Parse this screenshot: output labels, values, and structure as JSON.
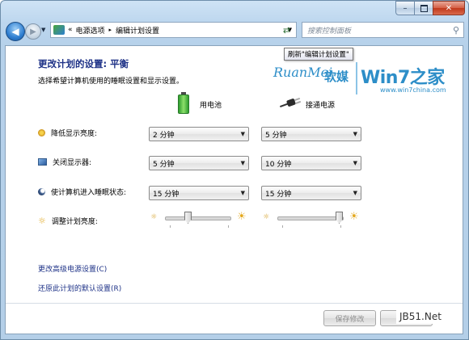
{
  "window": {
    "minimize_icon": "minimize-icon",
    "maximize_icon": "maximize-icon",
    "close_icon": "close-icon"
  },
  "address_bar": {
    "crumb_sep_left": "«",
    "crumb_1": "电源选项",
    "crumb_sep": "▸",
    "crumb_2": "编辑计划设置",
    "search_placeholder": "搜索控制面板"
  },
  "refresh_tooltip": "刷新\"编辑计划设置\"",
  "watermark": {
    "brand_en": "RuanMei",
    "brand_cn": "软媒",
    "win7": "Win7之家",
    "url": "www.win7china.com"
  },
  "main": {
    "title": "更改计划的设置: 平衡",
    "subtitle": "选择希望计算机使用的睡眠设置和显示设置。",
    "battery_label": "用电池",
    "plugged_label": "接通电源",
    "rows": [
      {
        "label": "降低显示亮度:",
        "battery": "2 分钟",
        "plugged": "5 分钟"
      },
      {
        "label": "关闭显示器:",
        "battery": "5 分钟",
        "plugged": "10 分钟"
      },
      {
        "label": "使计算机进入睡眠状态:",
        "battery": "15 分钟",
        "plugged": "15 分钟"
      }
    ],
    "brightness_label": "调整计划亮度:",
    "brightness_battery_level": 0.35,
    "brightness_plugged_level": 0.95,
    "link_advanced": "更改高级电源设置(C)",
    "link_restore": "还原此计划的默认设置(R)",
    "save_button": "保存修改",
    "cancel_button": "取消",
    "watermark_bottom": "JB51.Net"
  }
}
